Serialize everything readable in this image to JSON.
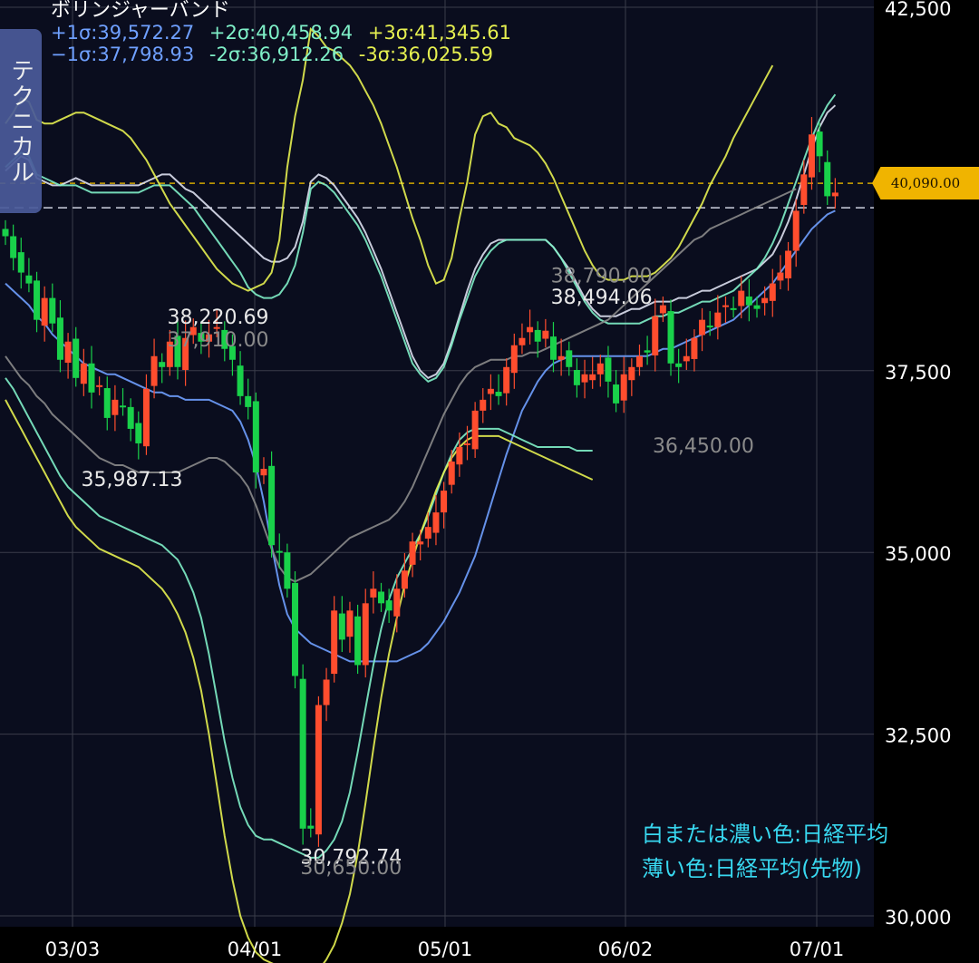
{
  "indicator": {
    "title": "ボリンジャーバンド",
    "bands": [
      {
        "label": "+1σ:39,572.27",
        "color": "#6fa0ff"
      },
      {
        "label": "+2σ:40,458.94",
        "color": "#7ff0c8"
      },
      {
        "label": "+3σ:41,345.61",
        "color": "#e6f050"
      },
      {
        "label": "−1σ:37,798.93",
        "color": "#6fa0ff"
      },
      {
        "label": "-2σ:36,912.26",
        "color": "#7ff0c8"
      },
      {
        "label": "-3σ:36,025.59",
        "color": "#e6f050"
      }
    ]
  },
  "side_tab": {
    "label": "テクニカル"
  },
  "current_price": {
    "label": "40,090.00",
    "value": 40090
  },
  "notes": {
    "line1": "白または濃い色:日経平均",
    "line2": "薄い色:日経平均(先物)"
  },
  "chart_data": {
    "type": "candlestick",
    "ylim": [
      30000,
      42500
    ],
    "y_ticks": [
      {
        "value": 42500,
        "label": "42,500"
      },
      {
        "value": 37500,
        "label": "37,500"
      },
      {
        "value": 35000,
        "label": "35,000"
      },
      {
        "value": 32500,
        "label": "32,500"
      },
      {
        "value": 30000,
        "label": "30,000"
      }
    ],
    "x_ticks": [
      "03/03",
      "04/01",
      "05/01",
      "06/02",
      "07/01"
    ],
    "annotations": [
      {
        "text": "38,220.69",
        "color": "#e8e8e8",
        "value": 38220.69,
        "idx": 26
      },
      {
        "text": "37,910.00",
        "color": "#8a8a8a",
        "value": 37910,
        "idx": 26
      },
      {
        "text": "35,987.13",
        "color": "#e8e8e8",
        "value": 35987.13,
        "idx": 15
      },
      {
        "text": "38,790.00",
        "color": "#8a8a8a",
        "value": 38790,
        "idx": 75
      },
      {
        "text": "38,494.06",
        "color": "#e8e8e8",
        "value": 38494.06,
        "idx": 75
      },
      {
        "text": "36,450.00",
        "color": "#8a8a8a",
        "value": 36450,
        "idx": 88
      },
      {
        "text": "30,792.74",
        "color": "#e8e8e8",
        "value": 30792.74,
        "idx": 43
      },
      {
        "text": "30,650.00",
        "color": "#8a8a8a",
        "value": 30650,
        "idx": 43
      }
    ],
    "candles_close": [
      39350,
      39050,
      38850,
      38700,
      38200,
      38500,
      38150,
      37650,
      37900,
      37400,
      37600,
      37200,
      37300,
      36850,
      37100,
      37000,
      36700,
      36500,
      37250,
      37700,
      37550,
      37900,
      37550,
      37950,
      38100,
      37900,
      38000,
      38100,
      37800,
      37650,
      37150,
      37000,
      36100,
      36150,
      35100,
      35000,
      34500,
      33300,
      31200,
      31200,
      32900,
      33250,
      34200,
      33800,
      34200,
      33450,
      34300,
      34500,
      34300,
      34200,
      34500,
      34750,
      35150,
      35150,
      35350,
      35550,
      35850,
      36250,
      36450,
      36500,
      36950,
      37100,
      37250,
      37150,
      37550,
      37850,
      37950,
      38100,
      37900,
      38050,
      37650,
      37700,
      37550,
      37300,
      37450,
      37450,
      37600,
      37350,
      37050,
      37450,
      37550,
      37700,
      37750,
      38250,
      38400,
      37600,
      37550,
      37700,
      37950,
      38200,
      38100,
      38300,
      38400,
      38350,
      38600,
      38400,
      38350,
      38500,
      38700,
      38850,
      39150,
      39700,
      40200,
      40750,
      40450,
      39900,
      39950
    ],
    "series": [
      {
        "name": "ma",
        "color": "#6fa0ff",
        "values": [
          38700,
          38600,
          38500,
          38400,
          38250,
          38150,
          38000,
          37900,
          37800,
          37700,
          37600,
          37550,
          37500,
          37450,
          37450,
          37400,
          37350,
          37300,
          37250,
          37200,
          37200,
          37150,
          37150,
          37100,
          37100,
          37100,
          37100,
          37050,
          37000,
          36950,
          36800,
          36550,
          36200,
          35700,
          35100,
          34550,
          34150,
          33950,
          33850,
          33750,
          33700,
          33650,
          33600,
          33550,
          33500,
          33500,
          33500,
          33500,
          33500,
          33500,
          33500,
          33550,
          33600,
          33650,
          33750,
          33900,
          34050,
          34250,
          34450,
          34700,
          34950,
          35300,
          35650,
          36000,
          36350,
          36650,
          36950,
          37150,
          37350,
          37500,
          37600,
          37650,
          37700,
          37700,
          37700,
          37700,
          37700,
          37700,
          37700,
          37700,
          37700,
          37700,
          37700,
          37750,
          37800,
          37800,
          37850,
          37900,
          37950,
          38000,
          38050,
          38100,
          38150,
          38200,
          38300,
          38400,
          38500,
          38600,
          38700,
          38850,
          39000,
          39150,
          39300,
          39450,
          39550,
          39650,
          39700
        ]
      },
      {
        "name": "+2σ",
        "color": "#dde0f0",
        "values": [
          40250,
          40350,
          40450,
          40400,
          40150,
          40100,
          40050,
          40050,
          40100,
          40150,
          40100,
          40050,
          40050,
          40050,
          40050,
          40050,
          40050,
          40050,
          40100,
          40150,
          40200,
          40200,
          40100,
          40000,
          39950,
          39850,
          39750,
          39650,
          39550,
          39450,
          39350,
          39250,
          39150,
          39050,
          39000,
          39000,
          39050,
          39200,
          39550,
          40100,
          40200,
          40150,
          40050,
          39900,
          39750,
          39600,
          39400,
          39150,
          38900,
          38600,
          38300,
          38000,
          37700,
          37500,
          37400,
          37450,
          37600,
          37900,
          38250,
          38600,
          38900,
          39100,
          39250,
          39300,
          39300,
          39300,
          39300,
          39300,
          39300,
          39300,
          39200,
          39050,
          38900,
          38700,
          38500,
          38350,
          38250,
          38250,
          38250,
          38300,
          38350,
          38350,
          38400,
          38450,
          38450,
          38450,
          38500,
          38500,
          38550,
          38600,
          38600,
          38650,
          38700,
          38750,
          38800,
          38850,
          38900,
          39000,
          39100,
          39300,
          39550,
          39850,
          40200,
          40550,
          40850,
          41050,
          41150
        ]
      },
      {
        "name": "+2σ fut",
        "color": "#7ff0c8",
        "values": [
          40300,
          40400,
          40500,
          40450,
          40200,
          40150,
          40100,
          40050,
          40050,
          40050,
          40000,
          39950,
          39950,
          39950,
          39950,
          39950,
          39950,
          39950,
          40000,
          40050,
          40050,
          40050,
          39950,
          39850,
          39750,
          39600,
          39450,
          39300,
          39150,
          39000,
          38850,
          38650,
          38550,
          38500,
          38500,
          38550,
          38700,
          38950,
          39400,
          40000,
          40100,
          40050,
          39950,
          39800,
          39650,
          39500,
          39300,
          39050,
          38800,
          38500,
          38200,
          37900,
          37600,
          37450,
          37350,
          37400,
          37550,
          37850,
          38200,
          38500,
          38800,
          39000,
          39150,
          39250,
          39300,
          39300,
          39300,
          39300,
          39300,
          39300,
          39200,
          39050,
          38850,
          38650,
          38450,
          38300,
          38200,
          38150,
          38150,
          38150,
          38150,
          38150,
          38200,
          38250,
          38250,
          38300,
          38300,
          38350,
          38400,
          38450,
          38450,
          38500,
          38550,
          38600,
          38700,
          38800,
          38900,
          39050,
          39250,
          39500,
          39800,
          40100,
          40400,
          40700,
          40950,
          41150,
          41300
        ]
      },
      {
        "name": "+3σ fut",
        "color": "#e6f050",
        "values": [
          40900,
          41050,
          41250,
          41200,
          40950,
          40900,
          40900,
          40950,
          41000,
          41050,
          41050,
          41000,
          40950,
          40900,
          40850,
          40800,
          40700,
          40550,
          40400,
          40200,
          40000,
          39800,
          39650,
          39500,
          39350,
          39200,
          39050,
          38900,
          38800,
          38700,
          38650,
          38600,
          38650,
          38700,
          38850,
          39300,
          40300,
          41000,
          41500,
          42200,
          42100,
          41950,
          41900,
          41800,
          41700,
          41550,
          41350,
          41150,
          40900,
          40600,
          40300,
          39950,
          39600,
          39300,
          38950,
          38700,
          38750,
          39050,
          39600,
          40100,
          40750,
          41000,
          41050,
          40900,
          40850,
          40700,
          40650,
          40600,
          40500,
          40350,
          40150,
          39900,
          39650,
          39400,
          39150,
          38950,
          38800,
          38750,
          38750,
          38750,
          38800,
          38800,
          38800,
          38850,
          38950,
          39050,
          39200,
          39400,
          39600,
          39800,
          40050,
          40250,
          40450,
          40700,
          40900,
          41100,
          41300,
          41500,
          41700
        ]
      },
      {
        "name": "−1σ",
        "color": "#8a8a8a",
        "values": [
          37700,
          37550,
          37400,
          37300,
          37150,
          37050,
          36900,
          36800,
          36700,
          36600,
          36500,
          36400,
          36300,
          36250,
          36200,
          36200,
          36150,
          36100,
          36100,
          36100,
          36100,
          36100,
          36100,
          36150,
          36200,
          36250,
          36300,
          36300,
          36250,
          36150,
          36050,
          35900,
          35650,
          35350,
          35050,
          34800,
          34650,
          34600,
          34650,
          34700,
          34800,
          34900,
          35000,
          35100,
          35200,
          35250,
          35300,
          35350,
          35400,
          35450,
          35550,
          35700,
          35900,
          36150,
          36400,
          36650,
          36900,
          37100,
          37300,
          37450,
          37550,
          37600,
          37650,
          37650,
          37650,
          37700,
          37700,
          37750,
          37750,
          37800,
          37850,
          37900,
          37950,
          38000,
          38050,
          38100,
          38150,
          38200,
          38300,
          38400,
          38500,
          38600,
          38700,
          38800,
          38900,
          39000,
          39100,
          39200,
          39300,
          39350,
          39450,
          39500,
          39550,
          39600,
          39650,
          39700,
          39750,
          39800,
          39850,
          39900,
          39950,
          40000
        ]
      },
      {
        "name": "-2σ fut",
        "color": "#7ff0c8",
        "values": [
          37400,
          37250,
          37050,
          36850,
          36650,
          36450,
          36250,
          36050,
          35900,
          35800,
          35700,
          35600,
          35500,
          35450,
          35400,
          35350,
          35300,
          35250,
          35200,
          35150,
          35100,
          35000,
          34900,
          34700,
          34450,
          34100,
          33600,
          33000,
          32400,
          31900,
          31500,
          31250,
          31100,
          31050,
          31050,
          31000,
          30950,
          30900,
          30850,
          30800,
          30800,
          30900,
          31050,
          31300,
          31700,
          32250,
          32850,
          33450,
          33950,
          34350,
          34650,
          34850,
          35050,
          35250,
          35500,
          35800,
          36100,
          36350,
          36550,
          36650,
          36700,
          36700,
          36700,
          36700,
          36650,
          36600,
          36550,
          36500,
          36450,
          36450,
          36450,
          36450,
          36450,
          36400,
          36400,
          36400
        ]
      },
      {
        "name": "-3σ fut",
        "color": "#e6f050",
        "values": [
          37100,
          36900,
          36700,
          36500,
          36300,
          36100,
          35900,
          35700,
          35500,
          35350,
          35250,
          35150,
          35050,
          35000,
          34950,
          34900,
          34850,
          34800,
          34700,
          34600,
          34500,
          34350,
          34150,
          33900,
          33550,
          33100,
          32500,
          31800,
          31100,
          30500,
          30000,
          29700,
          29500,
          29400,
          29350,
          29300,
          29250,
          29200,
          29200,
          29200,
          29250,
          29400,
          29600,
          29900,
          30300,
          30850,
          31550,
          32300,
          33000,
          33600,
          34100,
          34550,
          34900,
          35250,
          35550,
          35850,
          36100,
          36300,
          36450,
          36550,
          36600,
          36600,
          36600,
          36600,
          36550,
          36500,
          36450,
          36400,
          36350,
          36300,
          36250,
          36200,
          36150,
          36100,
          36050,
          36000
        ]
      }
    ]
  }
}
